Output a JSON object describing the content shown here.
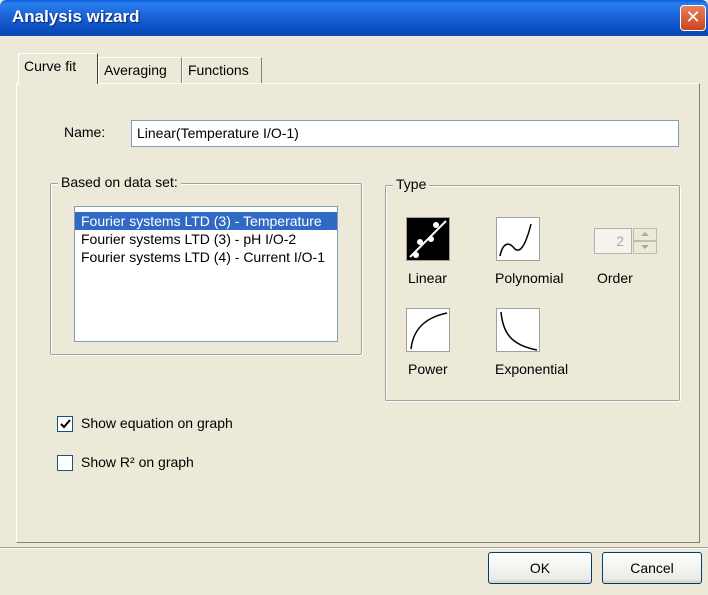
{
  "window": {
    "title": "Analysis wizard",
    "close_symbol": "✕"
  },
  "tabs": [
    {
      "label": "Curve fit",
      "active": true
    },
    {
      "label": "Averaging",
      "active": false
    },
    {
      "label": "Functions",
      "active": false
    }
  ],
  "name_field": {
    "label": "Name:",
    "value": "Linear(Temperature I/O-1)"
  },
  "dataset_group": {
    "title": "Based on data set:",
    "items": [
      {
        "label": "Fourier systems LTD (3) - Temperature",
        "selected": true
      },
      {
        "label": "Fourier systems LTD (3) - pH I/O-2",
        "selected": false
      },
      {
        "label": "Fourier systems LTD (4) - Current I/O-1",
        "selected": false
      }
    ]
  },
  "type_group": {
    "title": "Type",
    "selected": "linear",
    "options": {
      "linear": {
        "label": "Linear",
        "icon": "linear-fit-icon"
      },
      "polynomial": {
        "label": "Polynomial",
        "icon": "polynomial-fit-icon"
      },
      "power": {
        "label": "Power",
        "icon": "power-fit-icon"
      },
      "exponential": {
        "label": "Exponential",
        "icon": "exponential-fit-icon"
      }
    },
    "order": {
      "label": "Order",
      "value": "2",
      "enabled": false
    }
  },
  "options": {
    "show_equation": {
      "label": "Show equation on graph",
      "checked": true
    },
    "show_r2": {
      "label": "Show R² on graph",
      "checked": false
    }
  },
  "buttons": {
    "ok": "OK",
    "cancel": "Cancel"
  },
  "colors": {
    "title_bar": "#0a5fd8",
    "dialog_bg": "#ece9d8",
    "selection": "#316ac5",
    "close_button": "#d2522a"
  }
}
